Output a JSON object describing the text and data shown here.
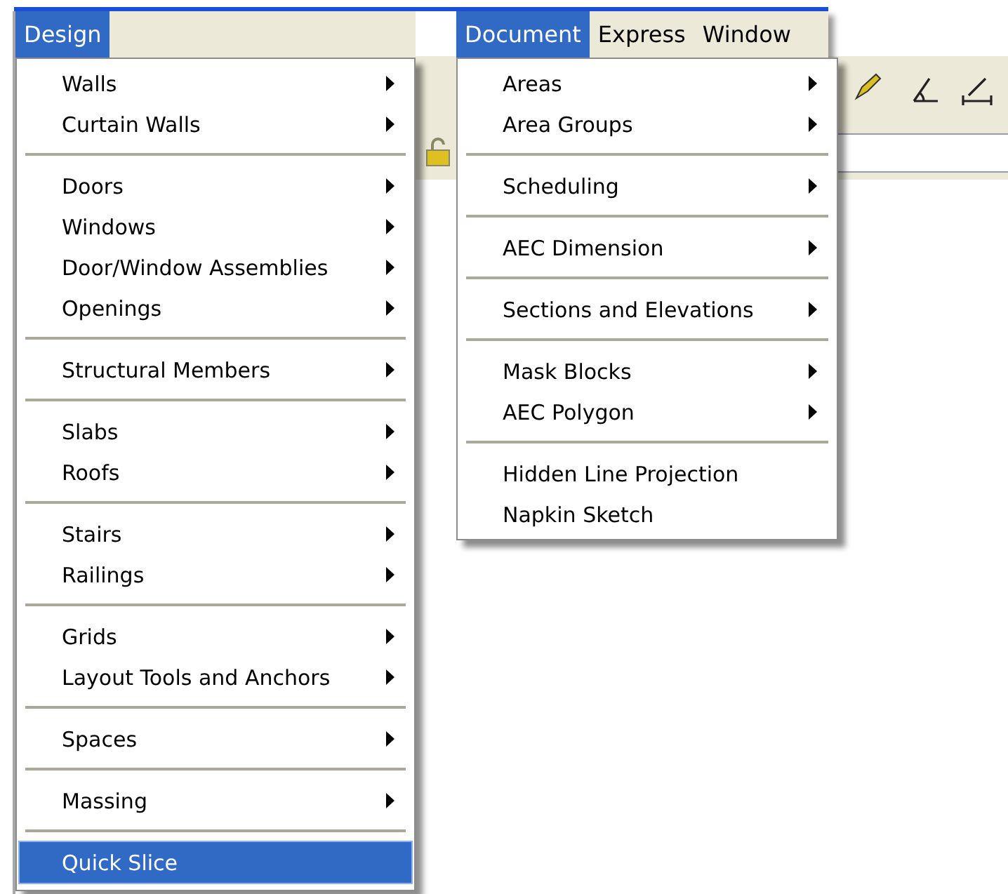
{
  "menus": [
    {
      "menu_bar": [
        {
          "label": "Design",
          "selected": true
        }
      ],
      "items": [
        {
          "kind": "item",
          "label": "Walls",
          "submenu": true,
          "selected": false
        },
        {
          "kind": "item",
          "label": "Curtain Walls",
          "submenu": true,
          "selected": false
        },
        {
          "kind": "separator"
        },
        {
          "kind": "item",
          "label": "Doors",
          "submenu": true,
          "selected": false
        },
        {
          "kind": "item",
          "label": "Windows",
          "submenu": true,
          "selected": false
        },
        {
          "kind": "item",
          "label": "Door/Window Assemblies",
          "submenu": true,
          "selected": false
        },
        {
          "kind": "item",
          "label": "Openings",
          "submenu": true,
          "selected": false
        },
        {
          "kind": "separator"
        },
        {
          "kind": "item",
          "label": "Structural Members",
          "submenu": true,
          "selected": false
        },
        {
          "kind": "separator"
        },
        {
          "kind": "item",
          "label": "Slabs",
          "submenu": true,
          "selected": false
        },
        {
          "kind": "item",
          "label": "Roofs",
          "submenu": true,
          "selected": false
        },
        {
          "kind": "separator"
        },
        {
          "kind": "item",
          "label": "Stairs",
          "submenu": true,
          "selected": false
        },
        {
          "kind": "item",
          "label": "Railings",
          "submenu": true,
          "selected": false
        },
        {
          "kind": "separator"
        },
        {
          "kind": "item",
          "label": "Grids",
          "submenu": true,
          "selected": false
        },
        {
          "kind": "item",
          "label": "Layout Tools and Anchors",
          "submenu": true,
          "selected": false
        },
        {
          "kind": "separator"
        },
        {
          "kind": "item",
          "label": "Spaces",
          "submenu": true,
          "selected": false
        },
        {
          "kind": "separator"
        },
        {
          "kind": "item",
          "label": "Massing",
          "submenu": true,
          "selected": false
        },
        {
          "kind": "separator"
        },
        {
          "kind": "item",
          "label": "Quick Slice",
          "submenu": false,
          "selected": true
        }
      ]
    },
    {
      "menu_bar": [
        {
          "label": "Document",
          "selected": true
        },
        {
          "label": "Express",
          "selected": false
        },
        {
          "label": "Window",
          "selected": false
        }
      ],
      "items": [
        {
          "kind": "item",
          "label": "Areas",
          "submenu": true,
          "selected": false
        },
        {
          "kind": "item",
          "label": "Area Groups",
          "submenu": true,
          "selected": false
        },
        {
          "kind": "separator"
        },
        {
          "kind": "item",
          "label": "Scheduling",
          "submenu": true,
          "selected": false
        },
        {
          "kind": "separator"
        },
        {
          "kind": "item",
          "label": "AEC Dimension",
          "submenu": true,
          "selected": false
        },
        {
          "kind": "separator"
        },
        {
          "kind": "item",
          "label": "Sections and Elevations",
          "submenu": true,
          "selected": false
        },
        {
          "kind": "separator"
        },
        {
          "kind": "item",
          "label": "Mask Blocks",
          "submenu": true,
          "selected": false
        },
        {
          "kind": "item",
          "label": "AEC Polygon",
          "submenu": true,
          "selected": false
        },
        {
          "kind": "separator"
        },
        {
          "kind": "item",
          "label": "Hidden Line Projection",
          "submenu": false,
          "selected": false
        },
        {
          "kind": "item",
          "label": "Napkin Sketch",
          "submenu": false,
          "selected": false
        }
      ]
    }
  ]
}
